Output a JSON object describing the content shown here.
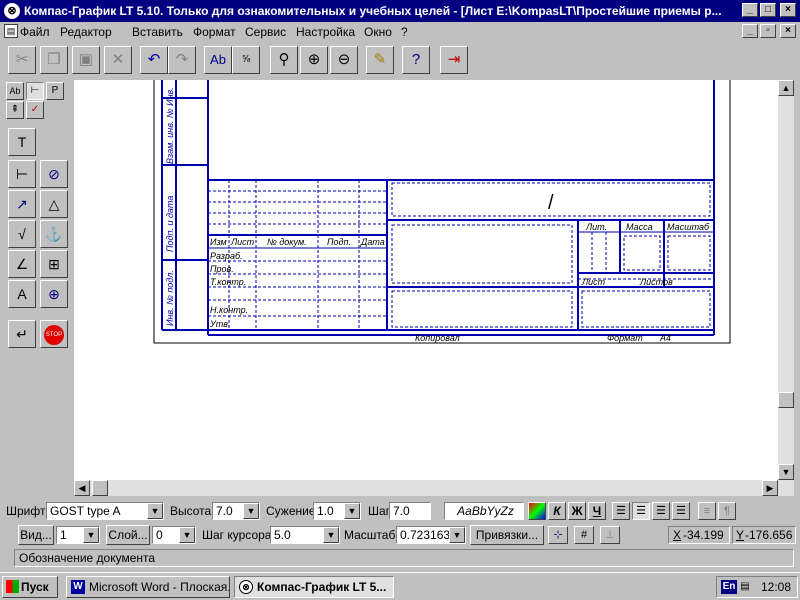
{
  "window": {
    "title": "Компас-График LT 5.10. Только для ознакомительных и учебных целей - [Лист E:\\KompasLT\\Простейшие приемы р..."
  },
  "menu": [
    "Файл",
    "Редактор",
    "Вставить",
    "Формат",
    "Сервис",
    "Настройка",
    "Окно",
    "?"
  ],
  "drawing": {
    "side_labels": [
      "Взам. инв. № Инв.",
      "Подп. и дата",
      "Инв. № подл."
    ],
    "title_block": {
      "col_headers": [
        "Изм",
        "Лист",
        "№ докум.",
        "Подп.",
        "Дата"
      ],
      "row_labels": [
        "Разраб.",
        "Пров.",
        "Т.контр.",
        "Н.контр.",
        "Утв."
      ],
      "lit": "Лит.",
      "massa": "Масса",
      "masshtab": "Масштаб",
      "list": "Лист",
      "listov": "Листов",
      "designation_mark": "/"
    },
    "bottom": {
      "kopiroval": "Копировал",
      "format_label": "Формат",
      "format_value": "А4"
    }
  },
  "fontbar": {
    "font_label": "Шрифт",
    "font_value": "GOST type A",
    "height_label": "Высота",
    "height_value": "7.0",
    "narrow_label": "Сужение",
    "narrow_value": "1.0",
    "step_label": "Шаг",
    "step_value": "7.0",
    "sample": "AaBbYyZz",
    "bold": "Ж",
    "italic": "К",
    "underline": "Ч"
  },
  "viewbar": {
    "view_btn": "Вид...",
    "view_value": "1",
    "layer_btn": "Слой...",
    "layer_value": "0",
    "cursor_step_label": "Шаг курсора",
    "cursor_step_value": "5.0",
    "scale_label": "Масштаб",
    "scale_value": "0.723163",
    "snaps_btn": "Привязки...",
    "x_label": "X",
    "x_value": "-34.199",
    "y_label": "Y",
    "y_value": "-176.656"
  },
  "status": {
    "text": "Обозначение документа"
  },
  "taskbar": {
    "start": "Пуск",
    "tasks": [
      "Microsoft Word - Плоская...",
      "Компас-График LT 5..."
    ],
    "lang": "En",
    "clock": "12:08"
  }
}
